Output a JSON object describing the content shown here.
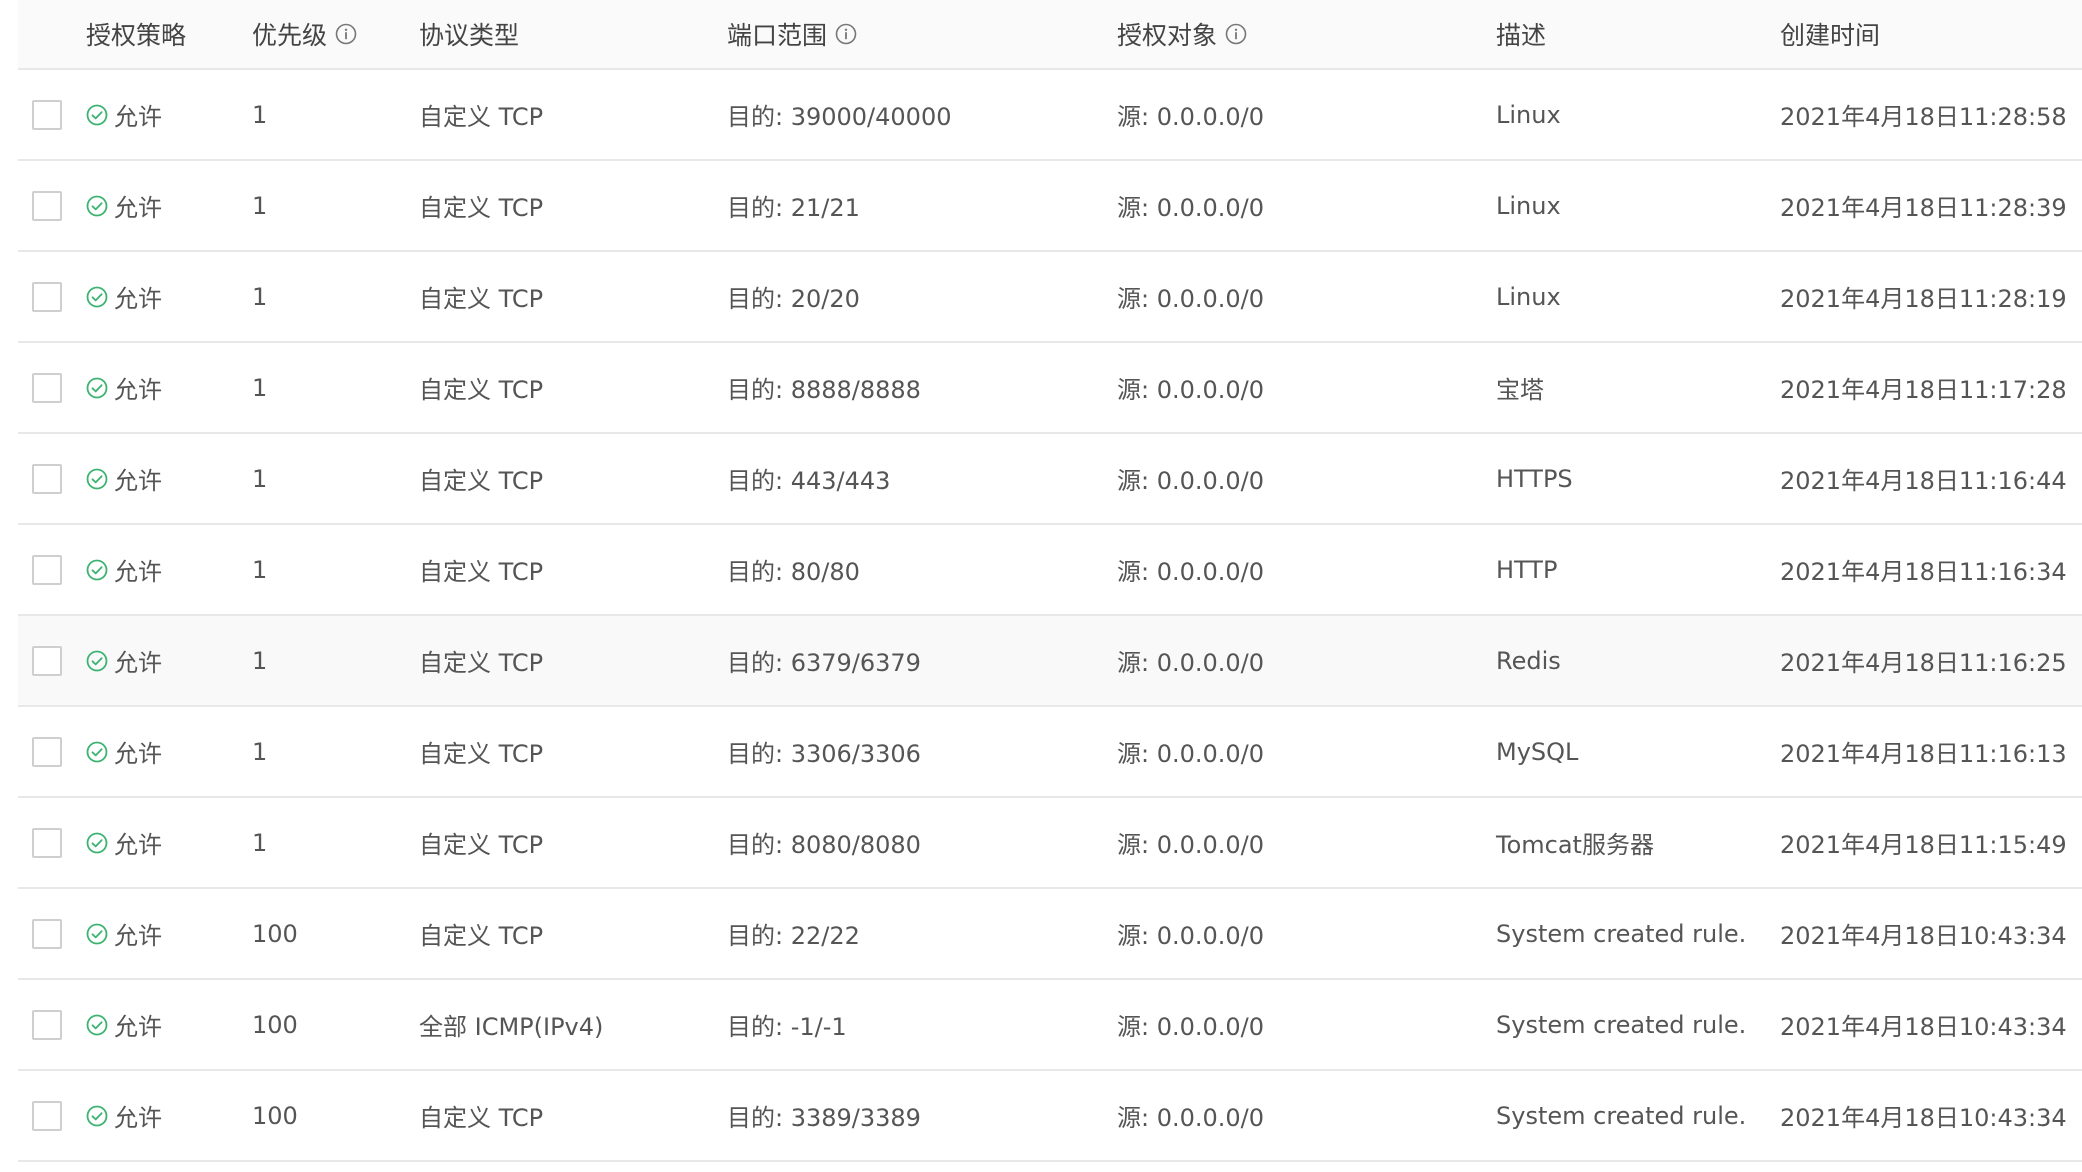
{
  "colors": {
    "allow_green": "#3cb371",
    "header_bg": "#fafafa",
    "border": "#e8e8e8",
    "text": "#555555"
  },
  "table": {
    "headers": {
      "policy": "授权策略",
      "priority": "优先级",
      "protocol": "协议类型",
      "port_range": "端口范围",
      "auth_object": "授权对象",
      "description": "描述",
      "created_time": "创建时间"
    },
    "header_icons": {
      "priority": "info-icon",
      "port_range": "info-icon",
      "auth_object": "info-icon"
    },
    "rows": [
      {
        "policy": "允许",
        "priority": "1",
        "protocol": "自定义 TCP",
        "port": "目的: 39000/40000",
        "object": "源: 0.0.0.0/0",
        "desc": "Linux",
        "time": "2021年4月18日11:28:58"
      },
      {
        "policy": "允许",
        "priority": "1",
        "protocol": "自定义 TCP",
        "port": "目的: 21/21",
        "object": "源: 0.0.0.0/0",
        "desc": "Linux",
        "time": "2021年4月18日11:28:39"
      },
      {
        "policy": "允许",
        "priority": "1",
        "protocol": "自定义 TCP",
        "port": "目的: 20/20",
        "object": "源: 0.0.0.0/0",
        "desc": "Linux",
        "time": "2021年4月18日11:28:19"
      },
      {
        "policy": "允许",
        "priority": "1",
        "protocol": "自定义 TCP",
        "port": "目的: 8888/8888",
        "object": "源: 0.0.0.0/0",
        "desc": "宝塔",
        "time": "2021年4月18日11:17:28"
      },
      {
        "policy": "允许",
        "priority": "1",
        "protocol": "自定义 TCP",
        "port": "目的: 443/443",
        "object": "源: 0.0.0.0/0",
        "desc": "HTTPS",
        "time": "2021年4月18日11:16:44"
      },
      {
        "policy": "允许",
        "priority": "1",
        "protocol": "自定义 TCP",
        "port": "目的: 80/80",
        "object": "源: 0.0.0.0/0",
        "desc": "HTTP",
        "time": "2021年4月18日11:16:34"
      },
      {
        "policy": "允许",
        "priority": "1",
        "protocol": "自定义 TCP",
        "port": "目的: 6379/6379",
        "object": "源: 0.0.0.0/0",
        "desc": "Redis",
        "time": "2021年4月18日11:16:25"
      },
      {
        "policy": "允许",
        "priority": "1",
        "protocol": "自定义 TCP",
        "port": "目的: 3306/3306",
        "object": "源: 0.0.0.0/0",
        "desc": "MySQL",
        "time": "2021年4月18日11:16:13"
      },
      {
        "policy": "允许",
        "priority": "1",
        "protocol": "自定义 TCP",
        "port": "目的: 8080/8080",
        "object": "源: 0.0.0.0/0",
        "desc": "Tomcat服务器",
        "time": "2021年4月18日11:15:49"
      },
      {
        "policy": "允许",
        "priority": "100",
        "protocol": "自定义 TCP",
        "port": "目的: 22/22",
        "object": "源: 0.0.0.0/0",
        "desc": "System created rule.",
        "time": "2021年4月18日10:43:34"
      },
      {
        "policy": "允许",
        "priority": "100",
        "protocol": "全部 ICMP(IPv4)",
        "port": "目的: -1/-1",
        "object": "源: 0.0.0.0/0",
        "desc": "System created rule.",
        "time": "2021年4月18日10:43:34"
      },
      {
        "policy": "允许",
        "priority": "100",
        "protocol": "自定义 TCP",
        "port": "目的: 3389/3389",
        "object": "源: 0.0.0.0/0",
        "desc": "System created rule.",
        "time": "2021年4月18日10:43:34"
      }
    ]
  }
}
